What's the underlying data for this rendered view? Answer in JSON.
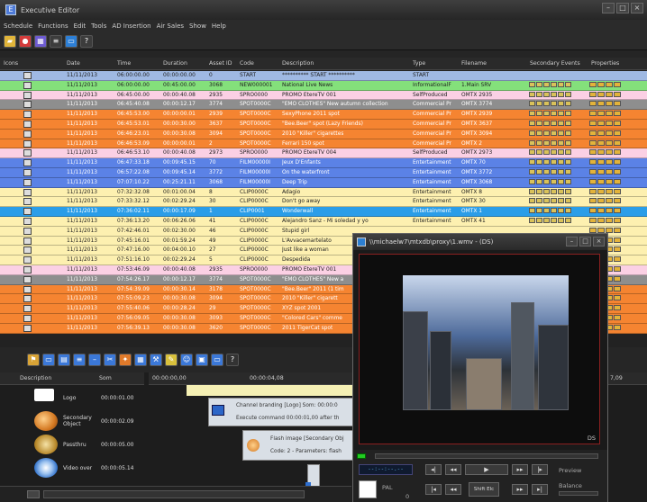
{
  "window_title": "Executive Editor",
  "menus": [
    "Schedule",
    "Functions",
    "Edit",
    "Tools",
    "AD Insertion",
    "Air Sales",
    "Show",
    "Help"
  ],
  "columns": {
    "icons": "Icons",
    "date": "Date",
    "time": "Time",
    "duration": "Duration",
    "asset": "Asset ID",
    "code": "Code",
    "desc": "Description",
    "type": "Type",
    "file": "Filename",
    "sec": "Secondary Events",
    "props": "Properties"
  },
  "rows": [
    {
      "date": "11/11/2013",
      "time": "06:00:00.00",
      "dur": "00:00:00.00",
      "asset": "0",
      "code": "START",
      "desc": "********** START **********",
      "type": "START",
      "file": "",
      "color": "#9fb9e3"
    },
    {
      "date": "11/11/2013",
      "time": "06:00:00.00",
      "dur": "00:45:00.00",
      "asset": "3068",
      "code": "NEW000001",
      "desc": "National Live News",
      "type": "InformationalF",
      "file": "1.Main SRV",
      "color": "#84e07b"
    },
    {
      "date": "11/11/2013",
      "time": "06:45:00.00",
      "dur": "00:00:40.08",
      "asset": "2935",
      "code": "SPRO0000",
      "desc": "PROMO EtereTV 001",
      "type": "SelfProduced",
      "file": "OMTX  2935",
      "color": "#fbd0e4"
    },
    {
      "date": "11/11/2013",
      "time": "06:45:40.08",
      "dur": "00:00:12.17",
      "asset": "3774",
      "code": "SPOT0000C",
      "desc": "\"EMO CLOTHES\" New autumn collection",
      "type": "Commercial Pr",
      "file": "OMTX  3774",
      "color": "#8e8e8e"
    },
    {
      "date": "11/11/2013",
      "time": "06:45:53.00",
      "dur": "00:00:00.01",
      "asset": "2939",
      "code": "SPOT0000C",
      "desc": "SexyPhone 2011 spot",
      "type": "Commercial Pr",
      "file": "OMTX  2939",
      "color": "#f58431"
    },
    {
      "date": "11/11/2013",
      "time": "06:45:53.01",
      "dur": "00:00:30.00",
      "asset": "3637",
      "code": "SPOT0000C",
      "desc": "\"Bee.Beer\" spot (Lazy Friends)",
      "type": "Commercial Pr",
      "file": "OMTX  3637",
      "color": "#f58431"
    },
    {
      "date": "11/11/2013",
      "time": "06:46:23.01",
      "dur": "00:00:30.08",
      "asset": "3094",
      "code": "SPOT0000C",
      "desc": "2010 \"Killer\" cigarettes",
      "type": "Commercial Pr",
      "file": "OMTX  3094",
      "color": "#f58431"
    },
    {
      "date": "11/11/2013",
      "time": "06:46:53.09",
      "dur": "00:00:00.01",
      "asset": "2",
      "code": "SPOT0000C",
      "desc": "Ferrari 150 spot",
      "type": "Commercial Pr",
      "file": "OMTX  2",
      "color": "#f58431"
    },
    {
      "date": "11/11/2013",
      "time": "06:46:53.10",
      "dur": "00:00:40.08",
      "asset": "2973",
      "code": "SPRO0000",
      "desc": "PROMO EtereTV 004",
      "type": "SelfProduced",
      "file": "OMTX  2973",
      "color": "#fbd0e4"
    },
    {
      "date": "11/11/2013",
      "time": "06:47:33.18",
      "dur": "00:09:45.15",
      "asset": "70",
      "code": "FILM00000I",
      "desc": "Jeux D'Enfants",
      "type": "Entertainment",
      "file": "OMTX  70",
      "color": "#5b82e6"
    },
    {
      "date": "11/11/2013",
      "time": "06:57:22.08",
      "dur": "00:09:45.14",
      "asset": "3772",
      "code": "FILM00000I",
      "desc": "On the waterfront",
      "type": "Entertainment",
      "file": "OMTX  3772",
      "color": "#5b82e6"
    },
    {
      "date": "11/11/2013",
      "time": "07:07:10.22",
      "dur": "00:25:21.11",
      "asset": "3068",
      "code": "FILM00000I",
      "desc": "Deep Trip",
      "type": "Entertainment",
      "file": "OMTX  3068",
      "color": "#5b82e6"
    },
    {
      "date": "11/11/2013",
      "time": "07:32:32.08",
      "dur": "00:01:00.04",
      "asset": "8",
      "code": "CLIP0000C",
      "desc": "Adagio",
      "type": "Entertainment",
      "file": "OMTX  8",
      "color": "#fdf0b0"
    },
    {
      "date": "11/11/2013",
      "time": "07:33:32.12",
      "dur": "00:02:29.24",
      "asset": "30",
      "code": "CLIP0000C",
      "desc": "Don't go away",
      "type": "Entertainment",
      "file": "OMTX  30",
      "color": "#fdf0b0"
    },
    {
      "date": "11/11/2013",
      "time": "07:36:02.11",
      "dur": "00:00:17.09",
      "asset": "1",
      "code": "CLIP0001",
      "desc": "Wonderwall",
      "type": "Entertainment",
      "file": "OMTX  1",
      "color": "#2a9de8"
    },
    {
      "date": "11/11/2013",
      "time": "07:36:13.20",
      "dur": "00:06:26.06",
      "asset": "41",
      "code": "CLIP0000C",
      "desc": "Alejandro Sanz - Mi soledad y yo",
      "type": "Entertainment",
      "file": "OMTX  41",
      "color": "#fdf0b0"
    },
    {
      "date": "11/11/2013",
      "time": "07:42:46.01",
      "dur": "00:02:30.00",
      "asset": "46",
      "code": "CLIP0000C",
      "desc": "Stupid girl",
      "type": "",
      "file": "",
      "color": "#fdf0b0"
    },
    {
      "date": "11/11/2013",
      "time": "07:45:16.01",
      "dur": "00:01:59.24",
      "asset": "49",
      "code": "CLIP0000C",
      "desc": "L'Avvacemartelato",
      "type": "",
      "file": "",
      "color": "#fdf0b0"
    },
    {
      "date": "11/11/2013",
      "time": "07:47:16.00",
      "dur": "00:04:00.10",
      "asset": "27",
      "code": "CLIP0000C",
      "desc": "Just like a woman",
      "type": "",
      "file": "",
      "color": "#fdf0b0"
    },
    {
      "date": "11/11/2013",
      "time": "07:51:16.10",
      "dur": "00:02:29.24",
      "asset": "5",
      "code": "CLIP0000C",
      "desc": "Despedida",
      "type": "",
      "file": "",
      "color": "#fdf0b0"
    },
    {
      "date": "11/11/2013",
      "time": "07:53:46.09",
      "dur": "00:00:40.08",
      "asset": "2935",
      "code": "SPRO0000",
      "desc": "PROMO EtereTV 001",
      "type": "",
      "file": "",
      "color": "#fbd0e4"
    },
    {
      "date": "11/11/2013",
      "time": "07:54:26.17",
      "dur": "00:00:12.17",
      "asset": "3774",
      "code": "SPOT0000C",
      "desc": "\"EMO CLOTHES\" New a",
      "type": "",
      "file": "",
      "color": "#8e8e8e"
    },
    {
      "date": "11/11/2013",
      "time": "07:54:39.09",
      "dur": "00:00:30.14",
      "asset": "3178",
      "code": "SPOT0000C",
      "desc": "\"Bee.Beer\" 2011 (1 tim",
      "type": "",
      "file": "",
      "color": "#f58431"
    },
    {
      "date": "11/11/2013",
      "time": "07:55:09.23",
      "dur": "00:00:30.08",
      "asset": "3094",
      "code": "SPOT0000C",
      "desc": "2010 \"Killer\" cigarett",
      "type": "",
      "file": "",
      "color": "#f58431"
    },
    {
      "date": "11/11/2013",
      "time": "07:55:40.06",
      "dur": "00:00:28.24",
      "asset": "29",
      "code": "SPOT0000C",
      "desc": "XYZ spot 2001",
      "type": "",
      "file": "",
      "color": "#f58431"
    },
    {
      "date": "11/11/2013",
      "time": "07:56:09.05",
      "dur": "00:00:30.08",
      "asset": "3093",
      "code": "SPOT0000C",
      "desc": "\"Colored Cars\" comme",
      "type": "",
      "file": "",
      "color": "#f58431"
    },
    {
      "date": "11/11/2013",
      "time": "07:56:39.13",
      "dur": "00:00:30.08",
      "asset": "3620",
      "code": "SPOT0000C",
      "desc": "2011 TigerCat spot",
      "type": "",
      "file": "",
      "color": "#f58431"
    }
  ],
  "library": {
    "header_desc": "Description",
    "header_som": "Som",
    "items": [
      {
        "name": "Logo",
        "dur": "00:00:01.00"
      },
      {
        "name": "Secondary Object",
        "dur": "00:00:02.09"
      },
      {
        "name": "Passthru",
        "dur": "00:00:05.00"
      },
      {
        "name": "Video over",
        "dur": "00:00:05.14"
      }
    ]
  },
  "timeline": {
    "start": "00:00:00,00",
    "mark": "00:00:04,08",
    "end": "7,09",
    "clip1_line1": "Channel branding [Logo] Som: 00:00:0",
    "clip1_line2": "Execute command 00:00:01,00 after th",
    "clip2_line1": "Flash image [Secondary Obj",
    "clip2_line2": "Code: 2 - Parameters: flash"
  },
  "preview": {
    "title": "\\\\michaelw7\\mtxdb\\proxy\\1.wmv - (DS)",
    "ds": "DS",
    "timecode": "--:--:--.--",
    "format": "PAL",
    "shuttle": "Shift Elc",
    "label_preview": "Preview",
    "label_balance": "Balance",
    "level": "0"
  }
}
